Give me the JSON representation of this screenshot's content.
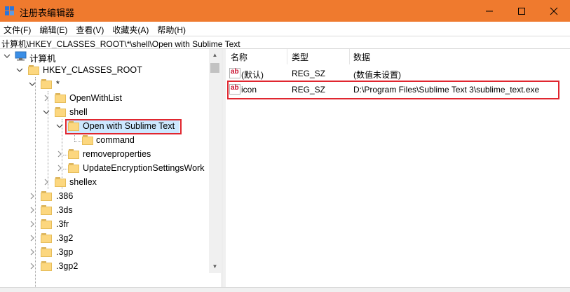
{
  "window": {
    "title": "注册表编辑器"
  },
  "menu": [
    "文件(F)",
    "编辑(E)",
    "查看(V)",
    "收藏夹(A)",
    "帮助(H)"
  ],
  "address": "计算机\\HKEY_CLASSES_ROOT\\*\\shell\\Open with Sublime Text",
  "tree": {
    "computer": "计算机",
    "hkcr": "HKEY_CLASSES_ROOT",
    "star": "*",
    "openwithlist": "OpenWithList",
    "shell": "shell",
    "open_sublime": "Open with Sublime Text",
    "command": "command",
    "removeproperties": "removeproperties",
    "updateenc": "UpdateEncryptionSettingsWork",
    "shellex": "shellex",
    "ext1": ".386",
    "ext2": ".3ds",
    "ext3": ".3fr",
    "ext4": ".3g2",
    "ext5": ".3gp",
    "ext6": ".3gp2"
  },
  "columns": {
    "name": "名称",
    "type": "类型",
    "data": "数据"
  },
  "values": [
    {
      "name": "(默认)",
      "type": "REG_SZ",
      "data": "(数值未设置)"
    },
    {
      "name": "icon",
      "type": "REG_SZ",
      "data": "D:\\Program Files\\Sublime Text 3\\sublime_text.exe"
    }
  ],
  "colors": {
    "titlebar": "#ef7a2e",
    "selection": "#cce8ff",
    "highlight_box": "#e0262f"
  }
}
